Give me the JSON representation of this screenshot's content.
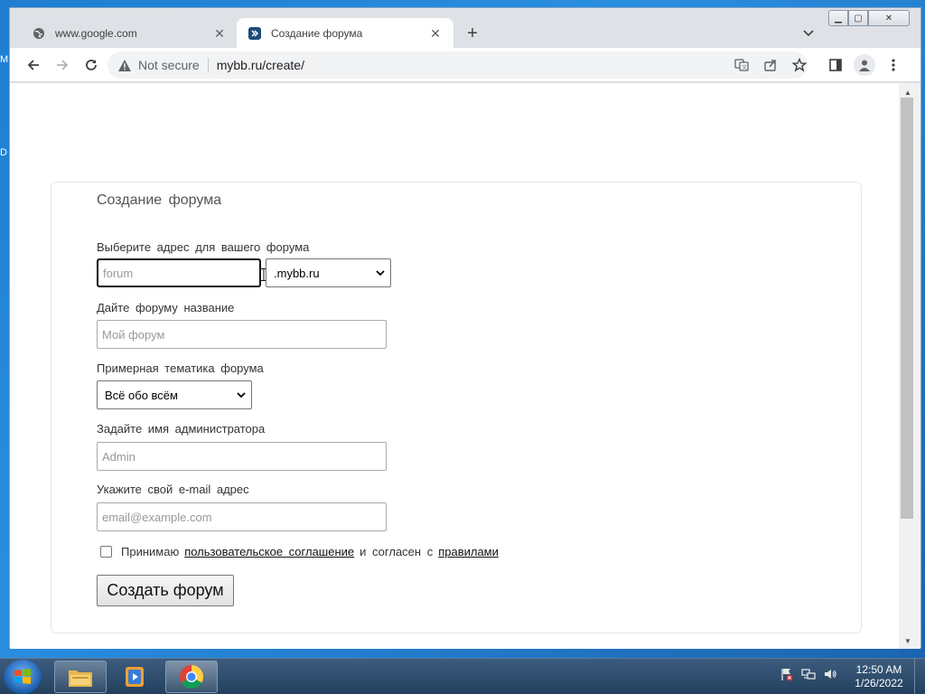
{
  "browser": {
    "tabs": [
      {
        "title": "www.google.com",
        "icon": "globe-icon",
        "active": false
      },
      {
        "title": "Создание форума",
        "icon": "mybb-icon",
        "active": true
      }
    ],
    "omnibox": {
      "security_label": "Not secure",
      "url": "mybb.ru/create/"
    }
  },
  "form": {
    "title": "Создание форума",
    "subdomain": {
      "label": "Выберите адрес для вашего форума",
      "placeholder": "forum",
      "value": ""
    },
    "domain_select": {
      "selected": ".mybb.ru"
    },
    "forum_name": {
      "label": "Дайте форуму название",
      "placeholder": "Мой форум"
    },
    "topic": {
      "label": "Примерная тематика форума",
      "selected": "Всё обо всём"
    },
    "admin": {
      "label": "Задайте имя администратора",
      "placeholder": "Admin"
    },
    "email": {
      "label": "Укажите свой e-mail адрес",
      "placeholder": "email@example.com"
    },
    "terms": {
      "prefix": "Принимаю",
      "agreement_link": "пользовательское соглашение",
      "middle": "и согласен с",
      "rules_link": "правилами",
      "checked": false
    },
    "submit_label": "Создать форум"
  },
  "desktop": {
    "letters": [
      "M",
      "D"
    ]
  },
  "taskbar": {
    "clock_time": "12:50 AM",
    "clock_date": "1/26/2022"
  },
  "colors": {
    "accent": "#1a73e8",
    "desktop": "#1f7ed0"
  }
}
